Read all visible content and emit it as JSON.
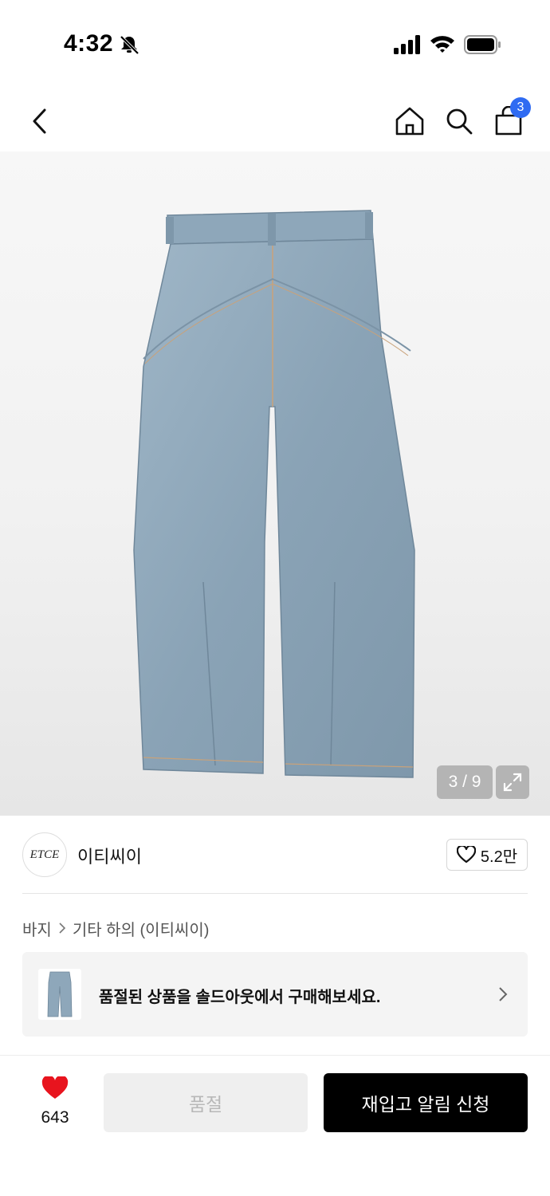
{
  "status_bar": {
    "time": "4:32"
  },
  "nav": {
    "cart_count": "3"
  },
  "gallery": {
    "counter": "3 / 9"
  },
  "brand": {
    "logo_text": "ETCE",
    "name": "이티씨이",
    "likes": "5.2만"
  },
  "breadcrumb": {
    "items": [
      "바지",
      "기타 하의 (이티씨이)"
    ]
  },
  "soldout_banner": {
    "text": "품절된 상품을 솔드아웃에서 구매해보세요."
  },
  "bottom_bar": {
    "wish_count": "643",
    "soldout_label": "품절",
    "restock_label": "재입고 알림 신청"
  },
  "colors": {
    "accent_blue": "#2f6bf2",
    "heart_red": "#e8141e",
    "primary_black": "#000000"
  }
}
